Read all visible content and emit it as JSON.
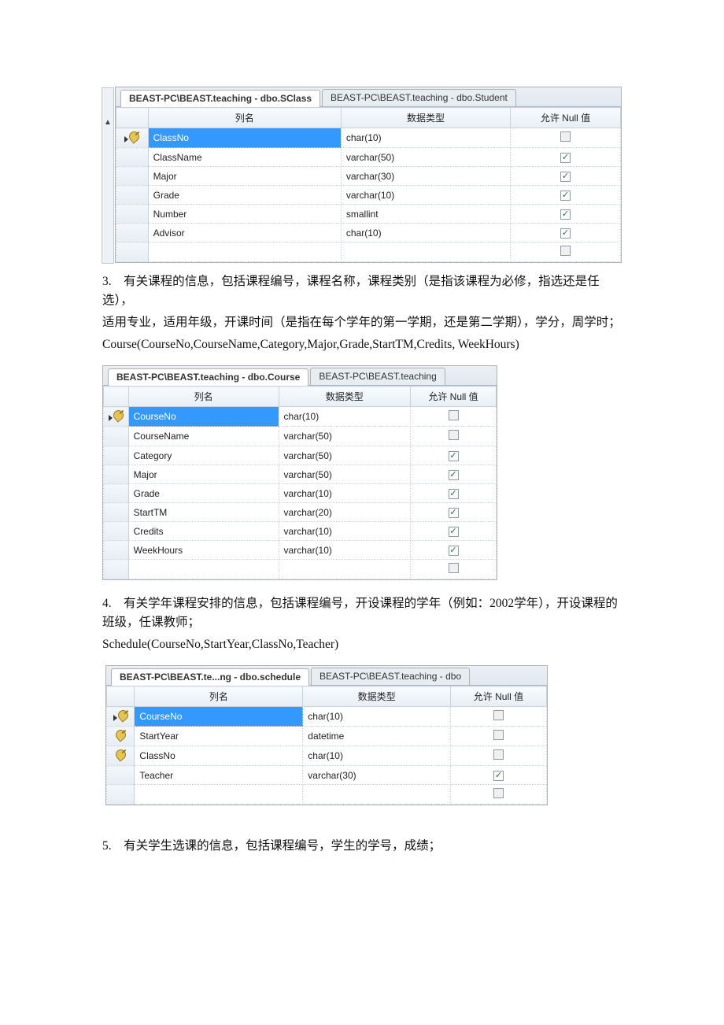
{
  "sclass": {
    "tab_active": "BEAST-PC\\BEAST.teaching - dbo.SClass",
    "tab_inactive": "BEAST-PC\\BEAST.teaching - dbo.Student",
    "headers": {
      "name": "列名",
      "type": "数据类型",
      "null": "允许 Null 值"
    },
    "rows": [
      {
        "name": "ClassNo",
        "type": "char(10)",
        "null": false,
        "pk": true,
        "selected": true
      },
      {
        "name": "ClassName",
        "type": "varchar(50)",
        "null": true,
        "pk": false
      },
      {
        "name": "Major",
        "type": "varchar(30)",
        "null": true,
        "pk": false
      },
      {
        "name": "Grade",
        "type": "varchar(10)",
        "null": true,
        "pk": false
      },
      {
        "name": "Number",
        "type": "smallint",
        "null": true,
        "pk": false
      },
      {
        "name": "Advisor",
        "type": "char(10)",
        "null": true,
        "pk": false
      }
    ]
  },
  "para3": {
    "line1": "3.　有关课程的信息，包括课程编号，课程名称，课程类别（是指该课程为必修，指选还是任选），",
    "line2": "适用专业，适用年级，开课时间（是指在每个学年的第一学期，还是第二学期），学分，周学时；",
    "line3": "Course(CourseNo,CourseName,Category,Major,Grade,StartTM,Credits, WeekHours)"
  },
  "course": {
    "tab_active": "BEAST-PC\\BEAST.teaching - dbo.Course",
    "tab_inactive": "BEAST-PC\\BEAST.teaching",
    "headers": {
      "name": "列名",
      "type": "数据类型",
      "null": "允许 Null 值"
    },
    "rows": [
      {
        "name": "CourseNo",
        "type": "char(10)",
        "null": false,
        "pk": true,
        "selected": true
      },
      {
        "name": "CourseName",
        "type": "varchar(50)",
        "null": false,
        "pk": false
      },
      {
        "name": "Category",
        "type": "varchar(50)",
        "null": true,
        "pk": false
      },
      {
        "name": "Major",
        "type": "varchar(50)",
        "null": true,
        "pk": false
      },
      {
        "name": "Grade",
        "type": "varchar(10)",
        "null": true,
        "pk": false
      },
      {
        "name": "StartTM",
        "type": "varchar(20)",
        "null": true,
        "pk": false
      },
      {
        "name": "Credits",
        "type": "varchar(10)",
        "null": true,
        "pk": false
      },
      {
        "name": "WeekHours",
        "type": "varchar(10)",
        "null": true,
        "pk": false
      }
    ]
  },
  "para4": {
    "line1": "4.　有关学年课程安排的信息，包括课程编号，开设课程的学年（例如：2002学年），开设课程的班级，任课教师；",
    "line2": "Schedule(CourseNo,StartYear,ClassNo,Teacher)"
  },
  "schedule": {
    "tab_active": "BEAST-PC\\BEAST.te...ng - dbo.schedule",
    "tab_inactive": "BEAST-PC\\BEAST.teaching - dbo",
    "headers": {
      "name": "列名",
      "type": "数据类型",
      "null": "允许 Null 值"
    },
    "rows": [
      {
        "name": "CourseNo",
        "type": "char(10)",
        "null": false,
        "pk": true,
        "selected": true
      },
      {
        "name": "StartYear",
        "type": "datetime",
        "null": false,
        "pk": true
      },
      {
        "name": "ClassNo",
        "type": "char(10)",
        "null": false,
        "pk": true
      },
      {
        "name": "Teacher",
        "type": "varchar(30)",
        "null": true,
        "pk": false
      }
    ]
  },
  "para5": {
    "line1": "5.　有关学生选课的信息，包括课程编号，学生的学号，成绩；"
  }
}
